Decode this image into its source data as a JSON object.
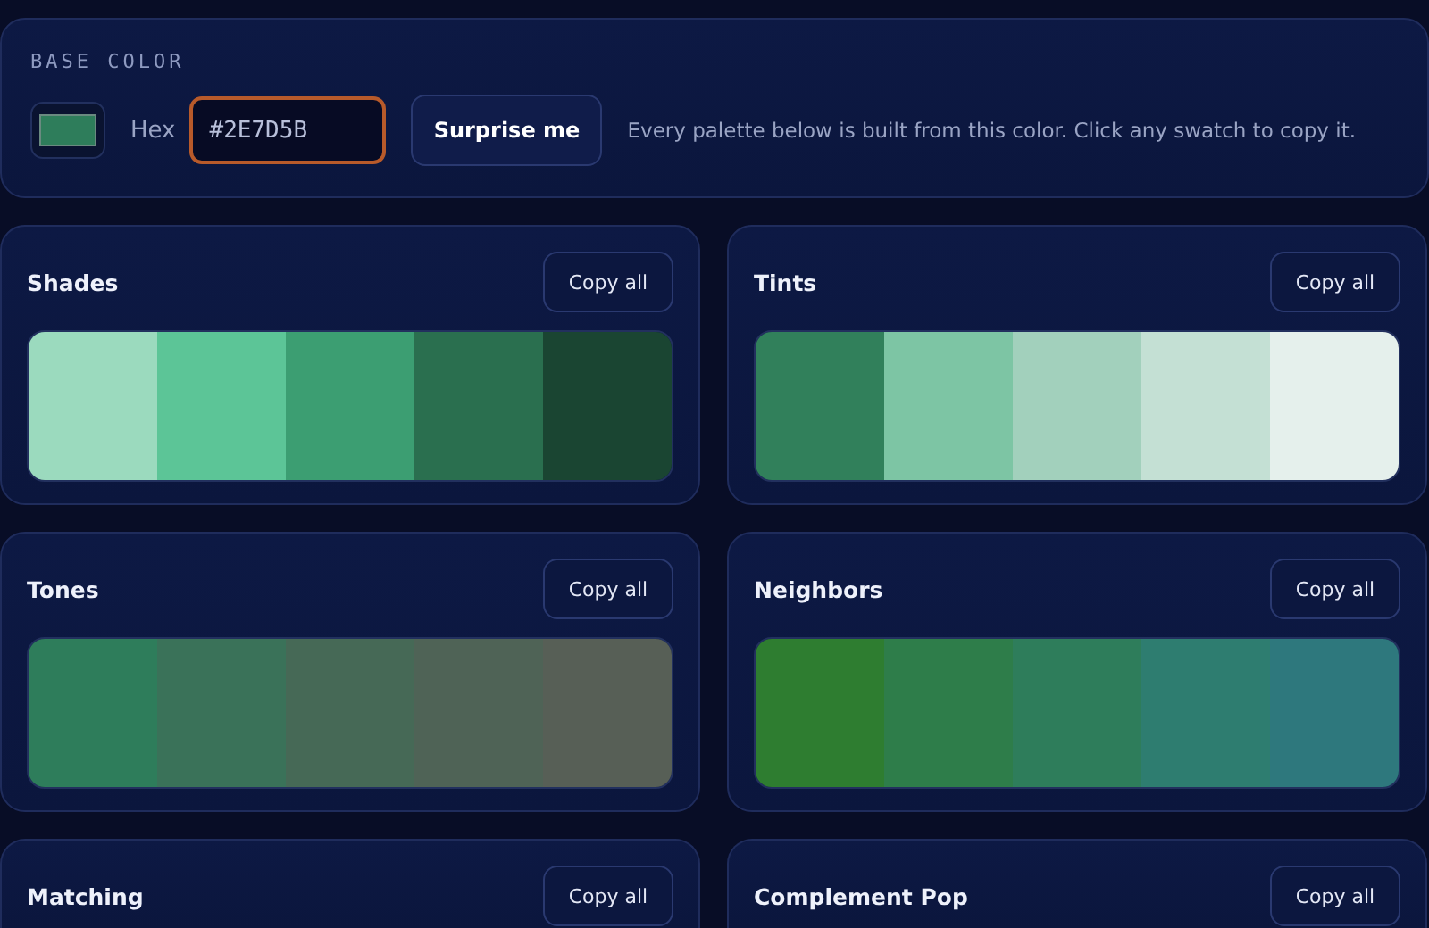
{
  "base_color": {
    "label": "BASE COLOR",
    "hex_label": "Hex",
    "hex_value": "#2E7D5B",
    "surprise_button": "Surprise me",
    "hint": "Every palette below is built from this color. Click any swatch to copy it."
  },
  "palettes": [
    {
      "title": "Shades",
      "copy_button": "Copy all",
      "swatches": [
        {
          "color": "#9bdabe"
        },
        {
          "color": "#5cc597"
        },
        {
          "color": "#3c9e72"
        },
        {
          "color": "#2a6f4f"
        },
        {
          "color": "#1a4532"
        }
      ]
    },
    {
      "title": "Tints",
      "copy_button": "Copy all",
      "swatches": [
        {
          "color": "#31805b"
        },
        {
          "color": "#7dc5a4"
        },
        {
          "color": "#a2d0bc"
        },
        {
          "color": "#c4e0d4"
        },
        {
          "color": "#e5f0ec"
        }
      ]
    },
    {
      "title": "Tones",
      "copy_button": "Copy all",
      "swatches": [
        {
          "color": "#2e7d5b"
        },
        {
          "color": "#3a7259"
        },
        {
          "color": "#466956"
        },
        {
          "color": "#4f6356"
        },
        {
          "color": "#575f56"
        }
      ]
    },
    {
      "title": "Neighbors",
      "copy_button": "Copy all",
      "swatches": [
        {
          "color": "#2e7d30"
        },
        {
          "color": "#2e7d4a"
        },
        {
          "color": "#2e7d5b"
        },
        {
          "color": "#2e7d70"
        },
        {
          "color": "#2e787d"
        }
      ]
    },
    {
      "title": "Matching",
      "copy_button": "Copy all"
    },
    {
      "title": "Complement Pop",
      "copy_button": "Copy all"
    }
  ]
}
